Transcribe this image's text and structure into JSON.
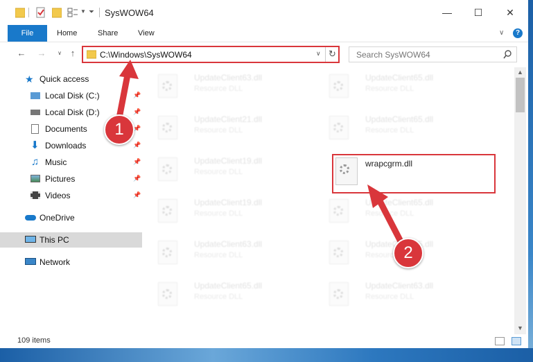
{
  "window": {
    "title": "SysWOW64"
  },
  "ribbon": {
    "file": "File",
    "home": "Home",
    "share": "Share",
    "view": "View"
  },
  "address": {
    "path": "C:\\Windows\\SysWOW64"
  },
  "search": {
    "placeholder": "Search SysWOW64"
  },
  "nav": {
    "quick_access": "Quick access",
    "items": [
      "Local Disk (C:)",
      "Local Disk (D:)",
      "Documents",
      "Downloads",
      "Music",
      "Pictures",
      "Videos"
    ],
    "onedrive": "OneDrive",
    "this_pc": "This PC",
    "network": "Network"
  },
  "files": {
    "left": [
      {
        "name": "UpdateClient63.dll",
        "type": "Resource DLL"
      },
      {
        "name": "UpdateClient21.dll",
        "type": "Resource DLL"
      },
      {
        "name": "UpdateClient19.dll",
        "type": "Resource DLL"
      },
      {
        "name": "UpdateClient19.dll",
        "type": "Resource DLL"
      },
      {
        "name": "UpdateClient63.dll",
        "type": "Resource DLL"
      },
      {
        "name": "UpdateClient65.dll",
        "type": "Resource DLL"
      }
    ],
    "right": [
      {
        "name": "UpdateClient65.dll",
        "type": "Resource DLL"
      },
      {
        "name": "UpdateClient65.dll",
        "type": "Resource DLL"
      },
      {
        "name": "wrapcgrm.dll",
        "type": ""
      },
      {
        "name": "UpdateClient65.dll",
        "type": "Resource DLL"
      },
      {
        "name": "UpdateClient65.dll",
        "type": "Resource DLL"
      },
      {
        "name": "UpdateClient63.dll",
        "type": "Resource DLL"
      }
    ]
  },
  "status": {
    "count": "109 items"
  },
  "callouts": {
    "one": "1",
    "two": "2"
  },
  "colors": {
    "accent": "#1979ca",
    "annotation": "#d9363b"
  }
}
